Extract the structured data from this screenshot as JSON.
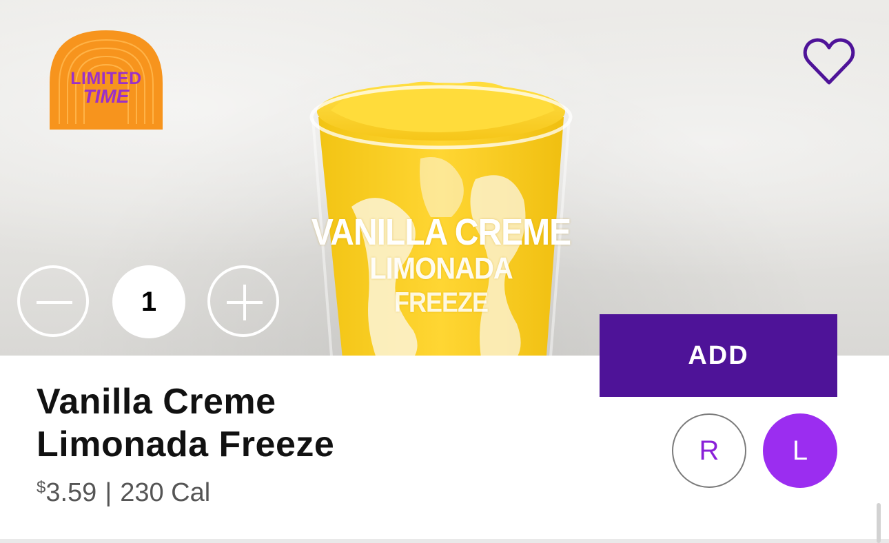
{
  "product": {
    "name_line1": "Vanilla Creme",
    "name_line2": "Limonada Freeze",
    "price_currency": "$",
    "price_amount": "3.59",
    "separator": "|",
    "calories": "230 Cal"
  },
  "hero": {
    "cup_text_line1": "VANILLA CREME",
    "cup_text_line2": "LIMONADA",
    "cup_text_line3": "FREEZE"
  },
  "badge": {
    "line1": "LIMITED",
    "line2": "TIME"
  },
  "quantity": {
    "value": "1"
  },
  "actions": {
    "add_label": "ADD"
  },
  "sizes": {
    "options": [
      "R",
      "L"
    ],
    "selected": "L"
  },
  "icons": {
    "favorite": "heart-outline-icon",
    "decrement": "minus-icon",
    "increment": "plus-icon"
  },
  "colors": {
    "brand_purple": "#4e1398",
    "selected_size": "#9b2df0",
    "size_text": "#8a20d8",
    "badge_orange": "#f7941d",
    "badge_text": "#9b30c8",
    "heart": "#4e1398"
  }
}
